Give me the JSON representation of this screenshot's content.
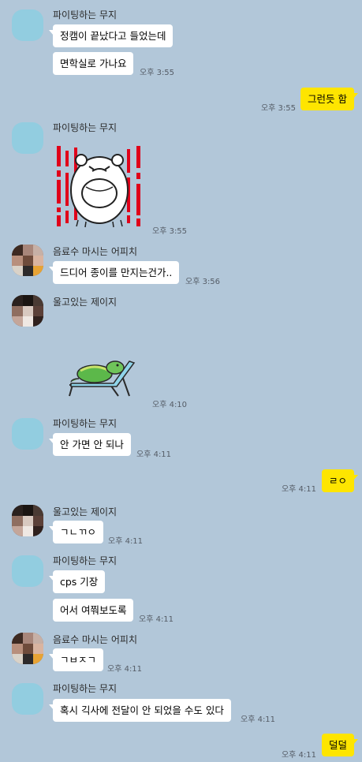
{
  "sender_fighting": "파이팅하는 무지",
  "sender_peach": "음료수 마시는 어피치",
  "sender_jay": "울고있는 제이지",
  "messages": {
    "m1": "정캠이 끝났다고 들었는데",
    "m2": "면학실로 가나요",
    "m3": "그런듯 함",
    "m5": "드디어 종이를 만지는건가..",
    "m7": "안 가면 안 되나",
    "m8": "ㄹㅇ",
    "m9": "ㄱㄴㄲㅇ",
    "m10": "cps 기장",
    "m11": "어서 여쭤보도록",
    "m12": "ㄱㅂㅈㄱ",
    "m13": "혹시 긱사에 전달이 안 되었을 수도 있다",
    "m14": "덜덜"
  },
  "times": {
    "t1": "오후 3:55",
    "t2": "오후 3:55",
    "t3": "오후 3:55",
    "t4": "오후 3:56",
    "t5": "오후 4:10",
    "t6": "오후 4:11",
    "t7": "오후 4:11",
    "t8": "오후 4:11",
    "t9": "오후 4:11",
    "t10": "오후 4:11",
    "t11": "오후 4:11",
    "t12": "오후 4:11"
  },
  "colors": {
    "background": "#b2c7d9",
    "my_bubble": "#fee500",
    "other_bubble": "#ffffff",
    "default_avatar": "#92cde0"
  },
  "icons": {
    "sticker_1": "scared-bear-sticker-icon",
    "sticker_2": "turtle-on-beach-chair-sticker-icon"
  }
}
